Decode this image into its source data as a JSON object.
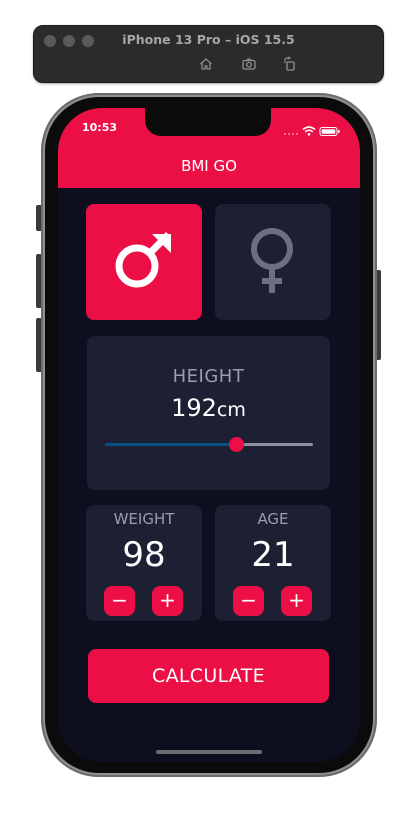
{
  "simulator": {
    "title": "iPhone 13 Pro – iOS 15.5"
  },
  "status_bar": {
    "time": "10:53"
  },
  "app": {
    "title": "BMI GO"
  },
  "gender": {
    "selected": "male"
  },
  "height": {
    "label": "HEIGHT",
    "value": "192",
    "unit": "cm",
    "slider_fraction": 0.63
  },
  "weight": {
    "label": "WEIGHT",
    "value": "98",
    "minus_label": "−",
    "plus_label": "+"
  },
  "age": {
    "label": "AGE",
    "value": "21",
    "minus_label": "−",
    "plus_label": "+"
  },
  "calculate_label": "CALCULATE",
  "colors": {
    "accent": "#ec0f45",
    "background": "#0d0f1e",
    "card": "#1d1f33",
    "slider_active": "#0a4f86"
  }
}
